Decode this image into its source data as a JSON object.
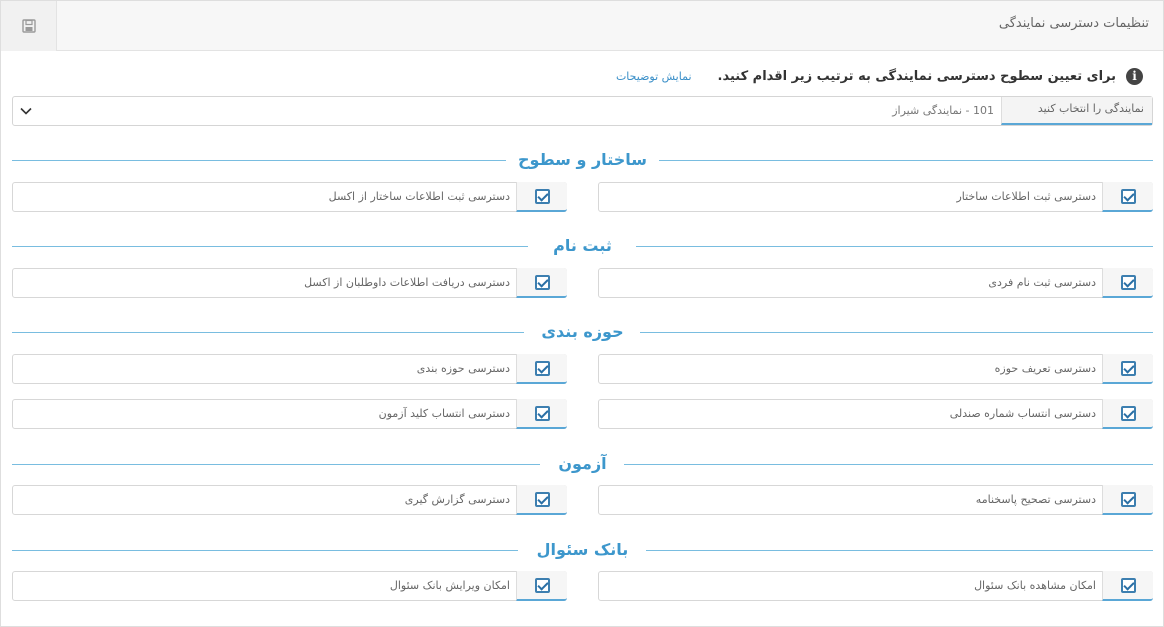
{
  "header": {
    "title": "تنظیمات دسترسی نمایندگی",
    "save_icon": "floppy-disk-icon"
  },
  "info": {
    "text": "برای تعیین سطوح دسترسی نمایندگی به ترتیب زیر اقدام کنید.",
    "link": "نمایش توضیحات",
    "icon": "info-icon"
  },
  "agency_select": {
    "label": "نمایندگی را انتخاب کنید",
    "value": "101 - نمایندگی شیراز"
  },
  "sections": [
    {
      "title": "ساختار و سطوح",
      "items": [
        {
          "label": "دسترسی ثبت اطلاعات ساختار",
          "checked": true
        },
        {
          "label": "دسترسی ثبت اطلاعات ساختار از اکسل",
          "checked": true
        }
      ]
    },
    {
      "title": "ثبت نام",
      "items": [
        {
          "label": "دسترسی ثبت نام فردی",
          "checked": true
        },
        {
          "label": "دسترسی دریافت اطلاعات داوطلبان از اکسل",
          "checked": true
        }
      ]
    },
    {
      "title": "حوزه بندی",
      "items": [
        {
          "label": "دسترسی تعریف حوزه",
          "checked": true
        },
        {
          "label": "دسترسی حوزه بندی",
          "checked": true
        },
        {
          "label": "دسترسی انتساب شماره صندلی",
          "checked": true
        },
        {
          "label": "دسترسی انتساب کلید آزمون",
          "checked": true
        }
      ]
    },
    {
      "title": "آزمون",
      "items": [
        {
          "label": "دسترسی تصحیح پاسخنامه",
          "checked": true
        },
        {
          "label": "دسترسی گزارش گیری",
          "checked": true
        }
      ]
    },
    {
      "title": "بانک سئوال",
      "items": [
        {
          "label": "امکان مشاهده بانک سئوال",
          "checked": true
        },
        {
          "label": "امکان ویرایش بانک سئوال",
          "checked": true
        }
      ]
    }
  ]
}
